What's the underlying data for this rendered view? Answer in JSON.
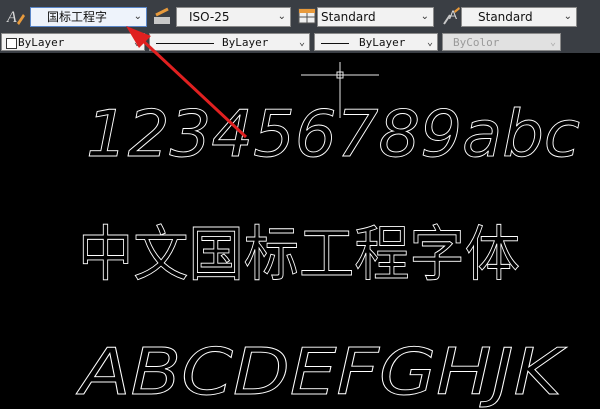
{
  "toolbar": {
    "text_style": {
      "value": "国标工程字",
      "icon": "text-style-icon"
    },
    "dim_style": {
      "value": "ISO-25",
      "icon": "dimension-style-icon"
    },
    "table_style": {
      "value": "Standard",
      "icon": "table-style-icon"
    },
    "mleader_style": {
      "value": "Standard",
      "icon": "multileader-style-icon"
    },
    "color": {
      "value": "ByLayer"
    },
    "linetype": {
      "value": "ByLayer"
    },
    "lineweight": {
      "value": "ByLayer"
    },
    "plot_style": {
      "value": "ByColor"
    }
  },
  "drawing": {
    "line1": "123456789abc",
    "line2": "中文国标工程字体",
    "line3": "ABCDEFGHJK"
  },
  "colors": {
    "toolbar_bg": "#3a3e44",
    "canvas_bg": "#000000",
    "annotation_arrow": "#e02020",
    "text_stroke": "#ffffff"
  }
}
